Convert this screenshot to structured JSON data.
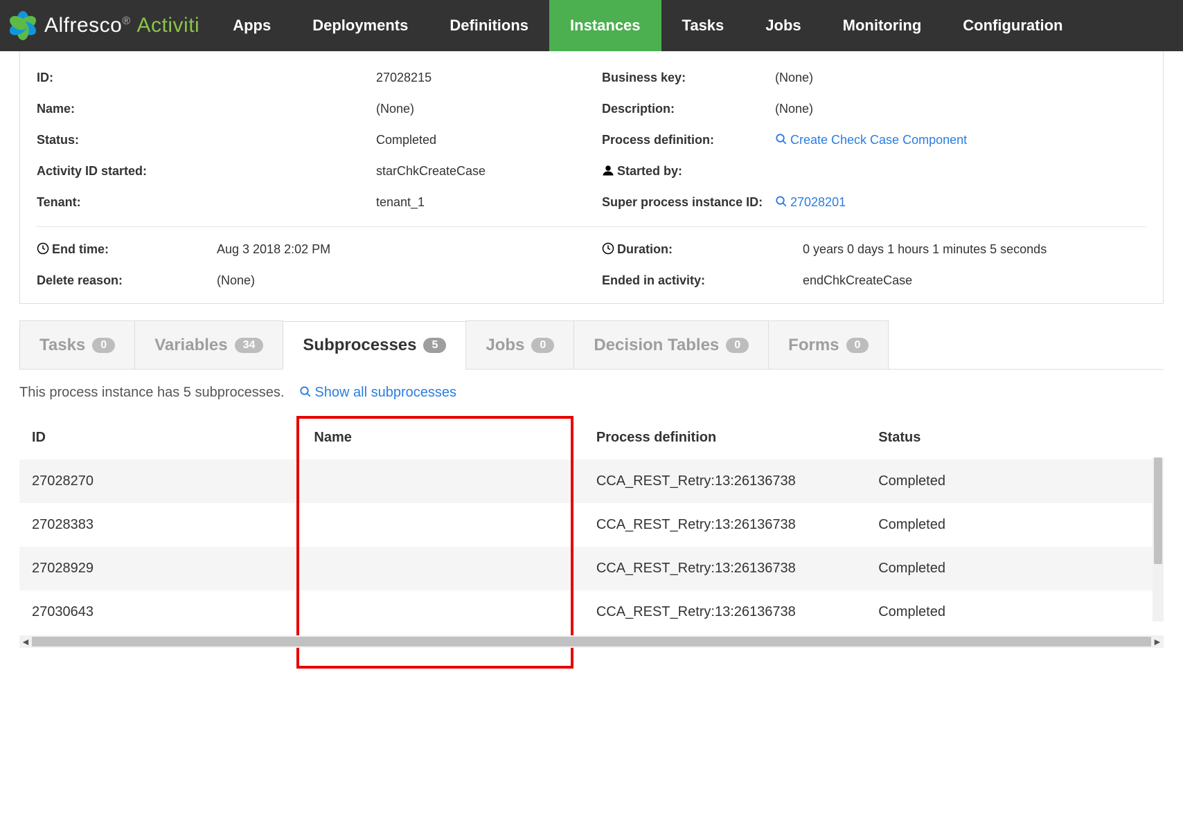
{
  "brand": {
    "alfresco": "Alfresco",
    "activiti": "Activiti"
  },
  "nav": {
    "items": [
      {
        "label": "Apps"
      },
      {
        "label": "Deployments"
      },
      {
        "label": "Definitions"
      },
      {
        "label": "Instances",
        "active": true
      },
      {
        "label": "Tasks"
      },
      {
        "label": "Jobs"
      },
      {
        "label": "Monitoring"
      },
      {
        "label": "Configuration"
      }
    ]
  },
  "details": {
    "left": {
      "id_label": "ID:",
      "id": "27028215",
      "name_label": "Name:",
      "name": "(None)",
      "status_label": "Status:",
      "status": "Completed",
      "activity_id_started_label": "Activity ID started:",
      "activity_id_started": "starChkCreateCase",
      "tenant_label": "Tenant:",
      "tenant": "tenant_1"
    },
    "right": {
      "business_key_label": "Business key:",
      "business_key": "(None)",
      "description_label": "Description:",
      "description": "(None)",
      "process_definition_label": "Process definition:",
      "process_definition": "Create Check Case Component",
      "started_by_label": "Started by:",
      "started_by": "",
      "super_process_label": "Super process instance ID:",
      "super_process_id": "27028201"
    },
    "bottom": {
      "end_time_label": "End time:",
      "end_time": "Aug 3 2018 2:02 PM",
      "duration_label": "Duration:",
      "duration": "0 years 0 days 1 hours 1 minutes 5 seconds",
      "delete_reason_label": "Delete reason:",
      "delete_reason": "(None)",
      "ended_in_activity_label": "Ended in activity:",
      "ended_in_activity": "endChkCreateCase"
    }
  },
  "tabs": [
    {
      "label": "Tasks",
      "count": "0"
    },
    {
      "label": "Variables",
      "count": "34"
    },
    {
      "label": "Subprocesses",
      "count": "5",
      "active": true
    },
    {
      "label": "Jobs",
      "count": "0"
    },
    {
      "label": "Decision Tables",
      "count": "0"
    },
    {
      "label": "Forms",
      "count": "0"
    }
  ],
  "subprocesses": {
    "summary": "This process instance has 5 subprocesses.",
    "show_all": "Show all subprocesses",
    "headers": {
      "id": "ID",
      "name": "Name",
      "pdef": "Process definition",
      "status": "Status"
    },
    "rows": [
      {
        "id": "27028270",
        "name": "",
        "pdef": "CCA_REST_Retry:13:26136738",
        "status": "Completed"
      },
      {
        "id": "27028383",
        "name": "",
        "pdef": "CCA_REST_Retry:13:26136738",
        "status": "Completed"
      },
      {
        "id": "27028929",
        "name": "",
        "pdef": "CCA_REST_Retry:13:26136738",
        "status": "Completed"
      },
      {
        "id": "27030643",
        "name": "",
        "pdef": "CCA_REST_Retry:13:26136738",
        "status": "Completed"
      }
    ]
  }
}
